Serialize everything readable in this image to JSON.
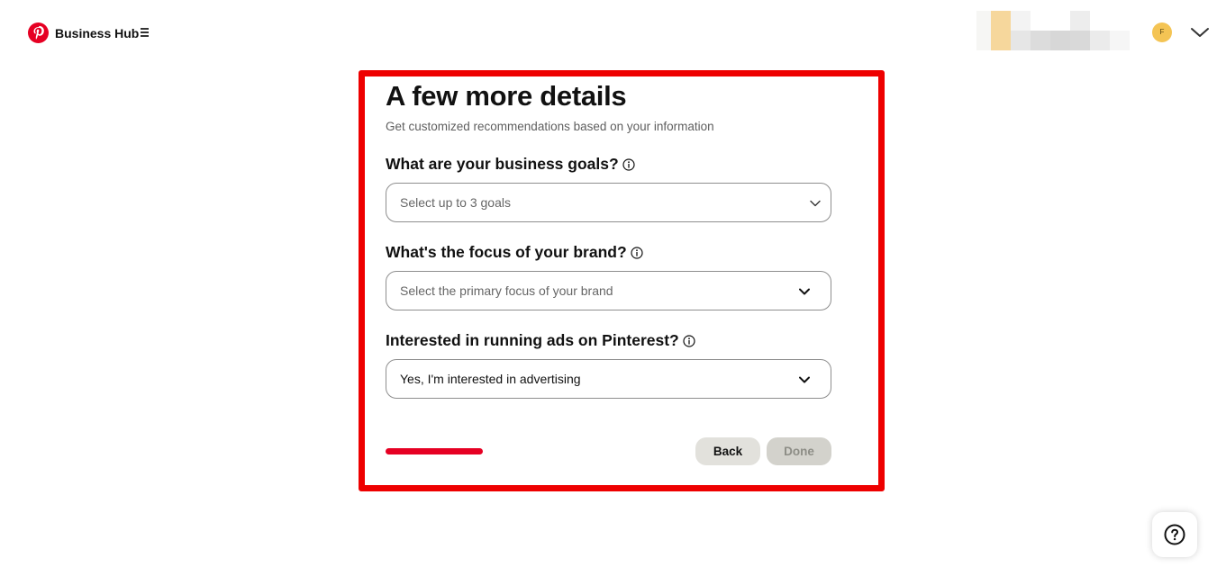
{
  "header": {
    "brand": "Business Hub",
    "avatar_initial": "F"
  },
  "card": {
    "title": "A few more details",
    "subtitle": "Get customized recommendations based on your information",
    "questions": [
      {
        "label": "What are your business goals?",
        "placeholder": "Select up to 3 goals",
        "value": ""
      },
      {
        "label": "What's the focus of your brand?",
        "placeholder": "Select the primary focus of your brand",
        "value": ""
      },
      {
        "label": "Interested in running ads on Pinterest?",
        "placeholder": "",
        "value": "Yes, I'm interested in advertising"
      }
    ],
    "progress_fraction": 1.0,
    "back_label": "Back",
    "done_label": "Done"
  },
  "colors": {
    "brand_red": "#e60023",
    "highlight_red": "#ee0000",
    "avatar": "#f4c454"
  },
  "icons": [
    "pinterest-logo-icon",
    "hamburger-icon",
    "chevron-down-icon",
    "info-icon",
    "help-icon"
  ]
}
